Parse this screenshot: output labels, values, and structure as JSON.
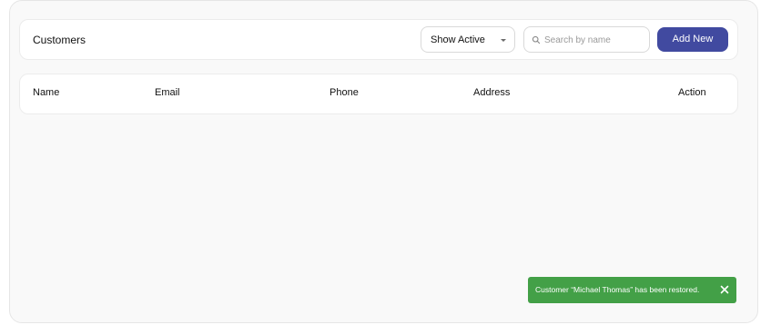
{
  "header": {
    "title": "Customers"
  },
  "filter": {
    "selected": "Show Active",
    "icon": "chevron-down-icon"
  },
  "search": {
    "placeholder": "Search by name",
    "value": "",
    "icon": "search-icon"
  },
  "actions": {
    "add_label": "Add New"
  },
  "table": {
    "columns": [
      "Name",
      "Email",
      "Phone",
      "Address",
      "Action"
    ],
    "rows": []
  },
  "toast": {
    "message": "Customer “Michael Thomas” has been restored.",
    "color": "#43a047",
    "close_icon": "close-icon"
  },
  "colors": {
    "accent": "#414aa0",
    "success": "#43a047"
  }
}
